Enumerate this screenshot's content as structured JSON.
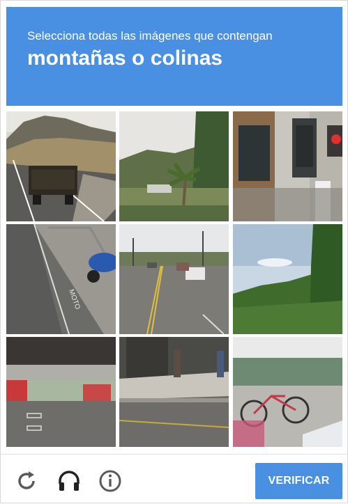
{
  "header": {
    "instruction": "Selecciona todas las imágenes que contengan",
    "target": "montañas o colinas"
  },
  "tiles": [
    {
      "row": 0,
      "col": 0,
      "icon": "truck-on-road-with-hills"
    },
    {
      "row": 0,
      "col": 1,
      "icon": "palm-trees-and-hills"
    },
    {
      "row": 0,
      "col": 2,
      "icon": "traffic-light-and-building"
    },
    {
      "row": 1,
      "col": 0,
      "icon": "bike-lane-with-motorcycle"
    },
    {
      "row": 1,
      "col": 1,
      "icon": "street-with-cars"
    },
    {
      "row": 1,
      "col": 2,
      "icon": "green-hills"
    },
    {
      "row": 2,
      "col": 0,
      "icon": "underpass-with-bus"
    },
    {
      "row": 2,
      "col": 1,
      "icon": "sidewalk-with-pedestrians"
    },
    {
      "row": 2,
      "col": 2,
      "icon": "bicycle-by-fence"
    }
  ],
  "footer": {
    "verify_label": "VERIFICAR",
    "reload_icon": "reload-icon",
    "audio_icon": "headphones-icon",
    "info_icon": "info-icon"
  },
  "colors": {
    "accent": "#4a90e2",
    "icon_gray": "#5a5a5a"
  }
}
